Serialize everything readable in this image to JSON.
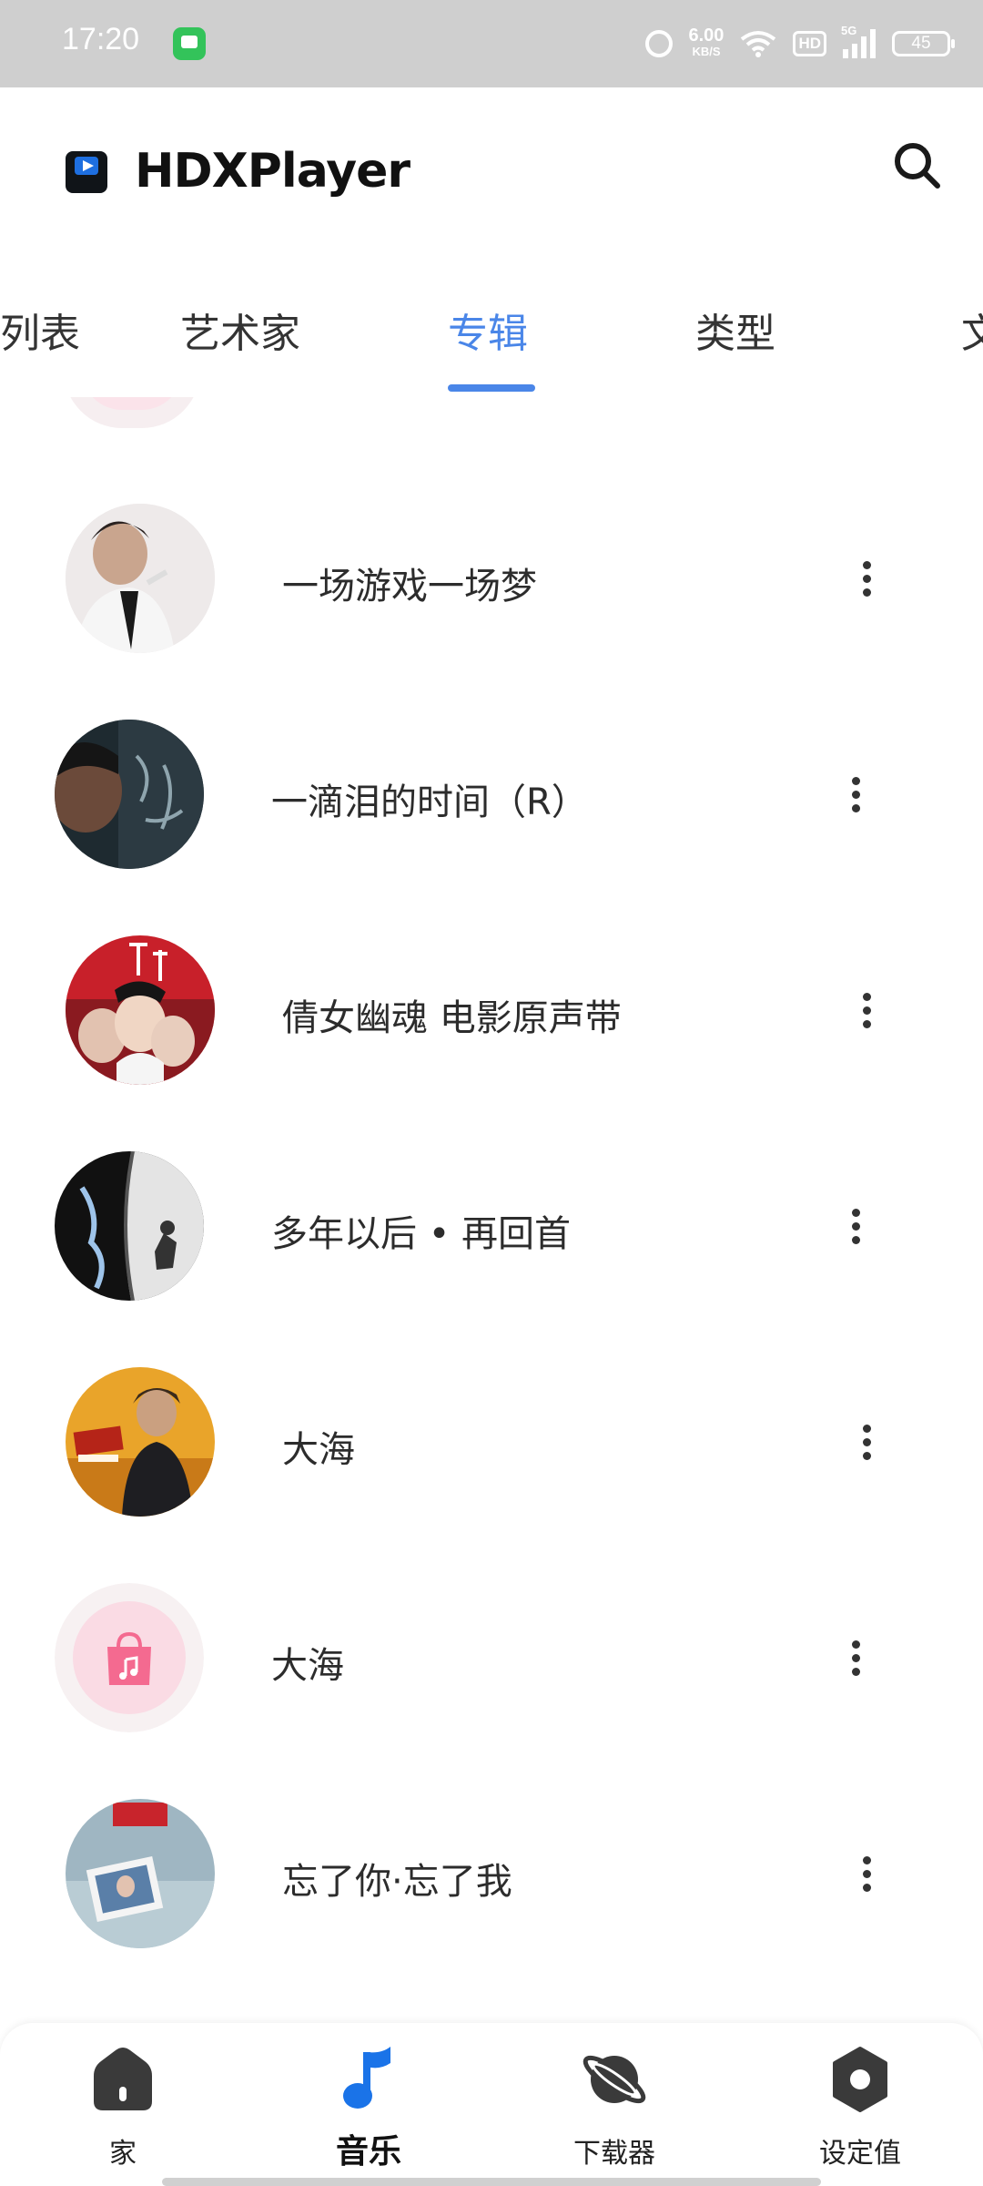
{
  "status_bar": {
    "time": "17:20",
    "net_speed": "6.00",
    "net_unit": "KB/S",
    "hd_badge": "HD",
    "signal_label": "5G",
    "battery": "45"
  },
  "app": {
    "title": "HDXPlayer"
  },
  "tabs": [
    {
      "label": "列表",
      "active": false
    },
    {
      "label": "艺术家",
      "active": false
    },
    {
      "label": "专辑",
      "active": true
    },
    {
      "label": "类型",
      "active": false
    },
    {
      "label": "文",
      "active": false
    }
  ],
  "albums": [
    {
      "title": "一场游戏一场梦",
      "art": "photo-portrait-cigarette"
    },
    {
      "title": "一滴泪的时间（R）",
      "art": "dark-portrait-calligraphy"
    },
    {
      "title": "倩女幽魂 电影原声带",
      "art": "movie-poster-red"
    },
    {
      "title": "多年以后 • 再回首",
      "art": "black-white-cover"
    },
    {
      "title": "大海",
      "art": "golden-field-portrait"
    },
    {
      "title": "大海",
      "art": "default-music-icon"
    },
    {
      "title": "忘了你·忘了我",
      "art": "photo-frame-blue"
    }
  ],
  "bottom_nav": [
    {
      "label": "家",
      "icon": "home-icon",
      "active": false
    },
    {
      "label": "音乐",
      "icon": "music-note-icon",
      "active": true
    },
    {
      "label": "下载器",
      "icon": "planet-icon",
      "active": false
    },
    {
      "label": "设定值",
      "icon": "settings-icon",
      "active": false
    }
  ],
  "colors": {
    "accent": "#4a86e8",
    "status_bar_bg": "#cfcfcf",
    "text_primary": "#2c2c2c"
  }
}
